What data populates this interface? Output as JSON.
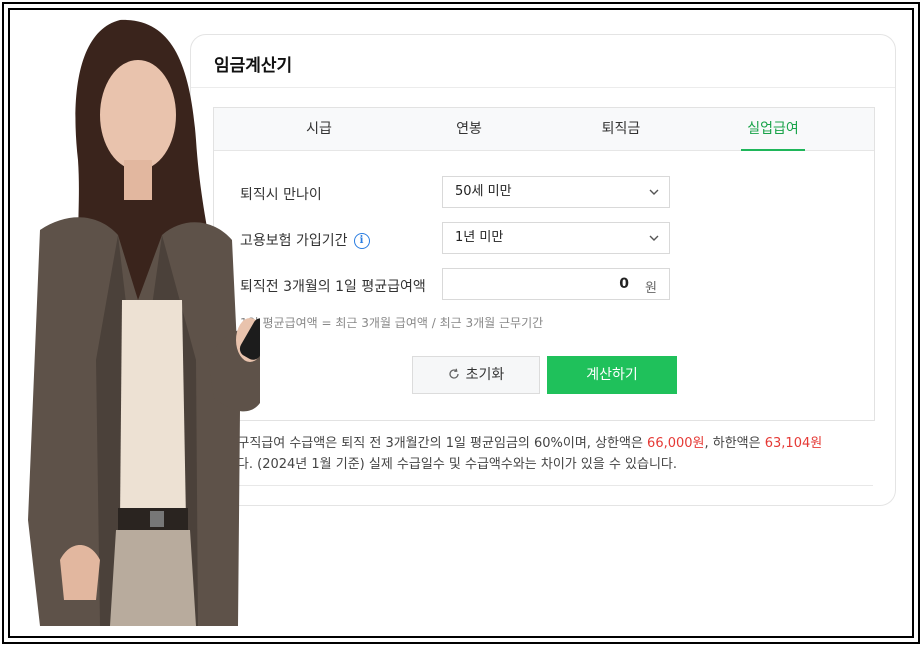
{
  "card": {
    "title": "임금계산기"
  },
  "tabs": [
    {
      "label": "시급",
      "active": false
    },
    {
      "label": "연봉",
      "active": false
    },
    {
      "label": "퇴직금",
      "active": false
    },
    {
      "label": "실업급여",
      "active": true
    }
  ],
  "form": {
    "age": {
      "label": "퇴직시 만나이",
      "value": "50세 미만"
    },
    "insurance": {
      "label": "고용보험 가입기간",
      "value": "1년 미만",
      "info_icon": "info-icon"
    },
    "wage": {
      "label": "퇴직전 3개월의 1일 평균급여액",
      "value": "0",
      "unit": "원"
    },
    "hint": "1일 평균급여액 = 최근 3개월 급여액 / 최근 3개월 근무기간"
  },
  "buttons": {
    "reset": "초기화",
    "calculate": "계산하기"
  },
  "notice": {
    "part1": "1일 구직급여 수급액은 퇴직 전 3개월간의 1일 평균임금의 60%이며, 상한액은 ",
    "upper": "66,000원",
    "part2": ", 하한액은 ",
    "lower": "63,104원",
    "part3": "입니다. (2024년 1월 기준) 실제 수급일수 및 수급액수와는 차이가 있을 수 있습니다."
  },
  "colors": {
    "accent": "#1fc15b",
    "active_tab": "#1aa34a",
    "highlight": "#e53935",
    "info": "#2a7de1"
  }
}
